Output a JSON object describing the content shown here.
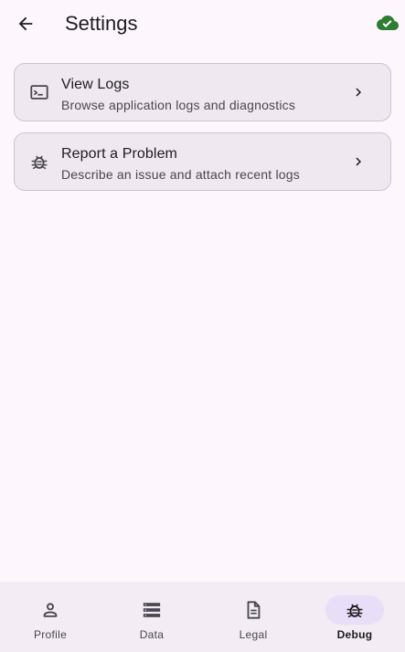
{
  "appbar": {
    "title": "Settings",
    "back_icon": "arrow-left-icon",
    "status_icon": "cloud-check-icon",
    "status_color": "#2e7d32"
  },
  "tiles": [
    {
      "title": "View Logs",
      "subtitle": "Browse application logs and diagnostics",
      "icon": "terminal-icon"
    },
    {
      "title": "Report a Problem",
      "subtitle": "Describe an issue and attach recent logs",
      "icon": "bug-icon"
    }
  ],
  "nav": {
    "items": [
      {
        "label": "Profile",
        "icon": "person-icon"
      },
      {
        "label": "Data",
        "icon": "storage-icon"
      },
      {
        "label": "Legal",
        "icon": "document-icon"
      },
      {
        "label": "Debug",
        "icon": "bug-icon"
      }
    ],
    "active": "Debug",
    "active_indicator_color": "#e8def8"
  }
}
